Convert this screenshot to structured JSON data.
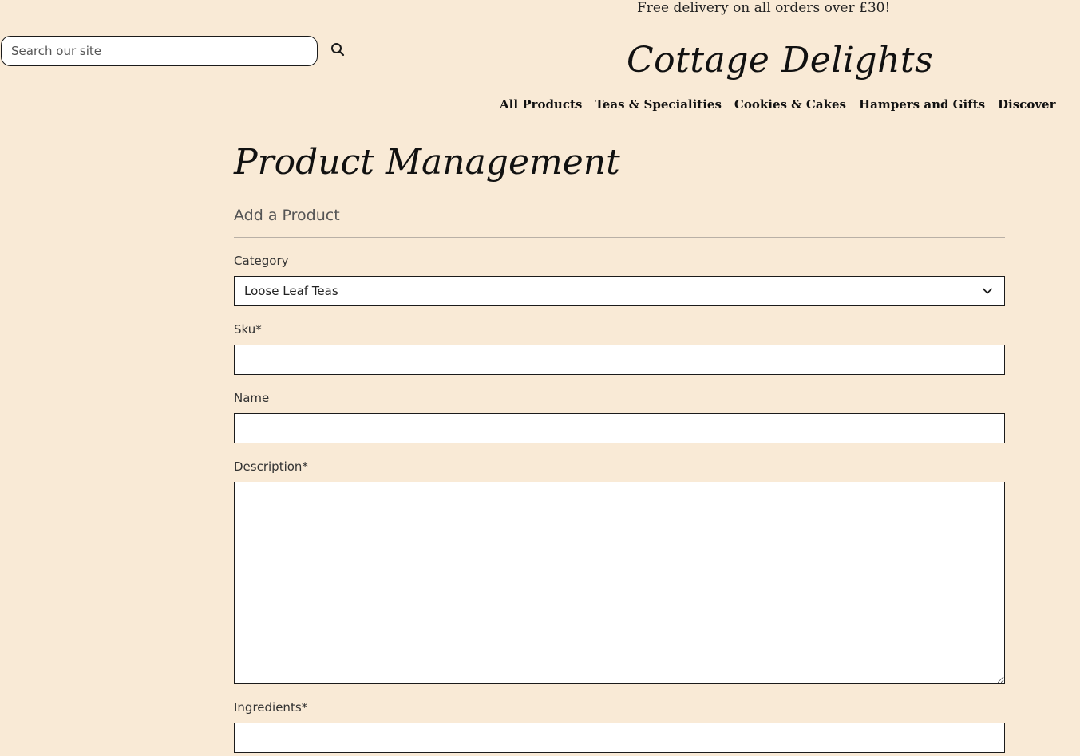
{
  "header": {
    "promo": "Free delivery on all orders over £30!",
    "logo": "Cottage Delights",
    "search": {
      "placeholder": "Search our site",
      "icon": "search-icon"
    },
    "nav": [
      {
        "label": "All Products"
      },
      {
        "label": "Teas & Specialities"
      },
      {
        "label": "Cookies & Cakes"
      },
      {
        "label": "Hampers and Gifts"
      },
      {
        "label": "Discover"
      }
    ]
  },
  "main": {
    "title": "Product Management",
    "subtitle": "Add a Product",
    "form": {
      "category": {
        "label": "Category",
        "value": "Loose Leaf Teas",
        "icon": "chevron-down-icon"
      },
      "sku": {
        "label": "Sku*",
        "value": ""
      },
      "name": {
        "label": "Name",
        "value": ""
      },
      "description": {
        "label": "Description*",
        "value": ""
      },
      "ingredients": {
        "label": "Ingredients*",
        "value": ""
      }
    }
  },
  "colors": {
    "background": "#f9ead6",
    "field_bg": "#ffffff",
    "border": "#1b1b1b",
    "subtitle": "#555555"
  }
}
